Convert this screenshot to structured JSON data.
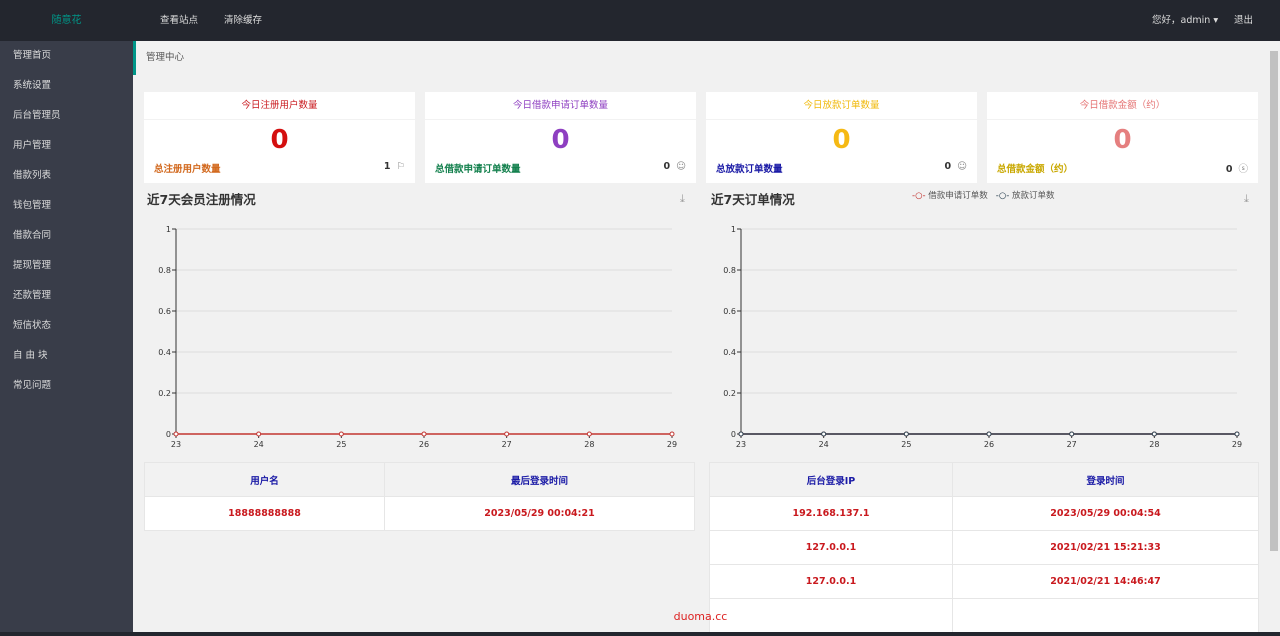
{
  "header": {
    "logo": "随意花",
    "nav": [
      "查看站点",
      "清除缓存"
    ],
    "greeting": "您好，admin",
    "logout": "退出"
  },
  "sidebar": {
    "items": [
      "管理首页",
      "系统设置",
      "后台管理员",
      "用户管理",
      "借款列表",
      "钱包管理",
      "借款合同",
      "提现管理",
      "还款管理",
      "短信状态",
      "自 由 块",
      "常见问题"
    ]
  },
  "breadcrumb": "管理中心",
  "cards": [
    {
      "title": "今日注册用户数量",
      "value": "0",
      "foot_label": "总注册用户数量",
      "foot_value": "1",
      "icon": "flag-icon",
      "title_color": "#c9191e",
      "value_color": "#d40f0f",
      "foot_color": "#d2691e"
    },
    {
      "title": "今日借款申请订单数量",
      "value": "0",
      "foot_label": "总借款申请订单数量",
      "foot_value": "0",
      "icon": "smile-icon",
      "title_color": "#8e3fc1",
      "value_color": "#8e3fc1",
      "foot_color": "#13804d"
    },
    {
      "title": "今日放款订单数量",
      "value": "0",
      "foot_label": "总放款订单数量",
      "foot_value": "0",
      "icon": "smile-icon",
      "title_color": "#f0b90b",
      "value_color": "#f5b914",
      "foot_color": "#1a1aa6"
    },
    {
      "title": "今日借款金额（约）",
      "value": "0",
      "foot_label": "总借款金额（约）",
      "foot_value": "0",
      "icon": "dollar-icon",
      "title_color": "#e57373",
      "value_color": "#e57f7f",
      "foot_color": "#c9a800"
    }
  ],
  "chart_data": [
    {
      "type": "line",
      "title": "近7天会员注册情况",
      "categories": [
        "23",
        "24",
        "25",
        "26",
        "27",
        "28",
        "29"
      ],
      "ylim": [
        0,
        1
      ],
      "yticks": [
        "0",
        "0.2",
        "0.4",
        "0.6",
        "0.8",
        "1"
      ],
      "grid": true,
      "series": [
        {
          "values": [
            0,
            0,
            0,
            0,
            0,
            0,
            0
          ],
          "color": "#c23531"
        }
      ]
    },
    {
      "type": "line",
      "title": "近7天订单情况",
      "categories": [
        "23",
        "24",
        "25",
        "26",
        "27",
        "28",
        "29"
      ],
      "ylim": [
        0,
        1
      ],
      "yticks": [
        "0",
        "0.2",
        "0.4",
        "0.6",
        "0.8",
        "1"
      ],
      "grid": true,
      "legend": "top-right",
      "series": [
        {
          "name": "借款申请订单数",
          "values": [
            0,
            0,
            0,
            0,
            0,
            0,
            0
          ],
          "color": "#c23531"
        },
        {
          "name": "放款订单数",
          "values": [
            0,
            0,
            0,
            0,
            0,
            0,
            0
          ],
          "color": "#2f4554"
        }
      ]
    }
  ],
  "users_table": {
    "headers": [
      "用户名",
      "最后登录时间"
    ],
    "rows": [
      [
        "18888888888",
        "2023/05/29 00:04:21"
      ]
    ]
  },
  "login_table": {
    "headers": [
      "后台登录IP",
      "登录时间"
    ],
    "rows": [
      [
        "192.168.137.1",
        "2023/05/29 00:04:54"
      ],
      [
        "127.0.0.1",
        "2021/02/21 15:21:33"
      ],
      [
        "127.0.0.1",
        "2021/02/21 14:46:47"
      ],
      [
        "",
        ""
      ]
    ]
  },
  "footer": "duoma.cc"
}
